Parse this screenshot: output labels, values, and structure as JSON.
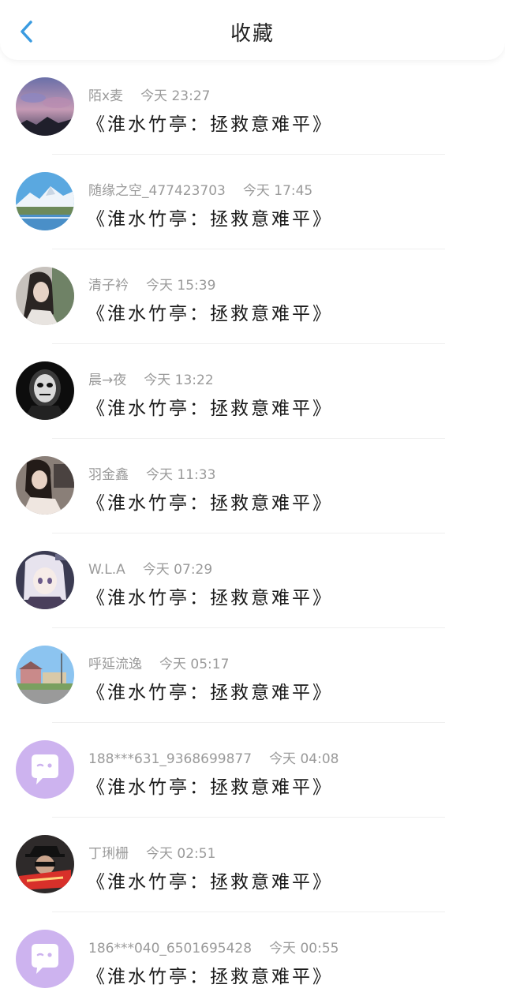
{
  "header": {
    "title": "收藏",
    "back_icon": "chevron-left-icon",
    "accent": "#3a9be0"
  },
  "items": [
    {
      "user": "陌x麦",
      "time": "今天 23:27",
      "content": "《淮水竹亭：拯救意难平》",
      "avatar": "sunset-sky"
    },
    {
      "user": "随缘之空_477423703",
      "time": "今天 17:45",
      "content": "《淮水竹亭：拯救意难平》",
      "avatar": "snowy-mountain"
    },
    {
      "user": "清子衿",
      "time": "今天 15:39",
      "content": "《淮水竹亭：拯救意难平》",
      "avatar": "girl-portrait"
    },
    {
      "user": "晨→夜",
      "time": "今天 13:22",
      "content": "《淮水竹亭：拯救意难平》",
      "avatar": "dark-mask"
    },
    {
      "user": "羽金鑫",
      "time": "今天 11:33",
      "content": "《淮水竹亭：拯救意难平》",
      "avatar": "girl-dark-hair"
    },
    {
      "user": "W.L.A",
      "time": "今天 07:29",
      "content": "《淮水竹亭：拯救意难平》",
      "avatar": "anime-girl"
    },
    {
      "user": "呼延流逸",
      "time": "今天 05:17",
      "content": "《淮水竹亭：拯救意难平》",
      "avatar": "street-house"
    },
    {
      "user": "188***631_9368699877",
      "time": "今天 04:08",
      "content": "《淮水竹亭：拯救意难平》",
      "avatar": "default-chat"
    },
    {
      "user": "丁琍栅",
      "time": "今天 02:51",
      "content": "《淮水竹亭：拯救意难平》",
      "avatar": "man-hat-red"
    },
    {
      "user": "186***040_6501695428",
      "time": "今天 00:55",
      "content": "《淮水竹亭：拯救意难平》",
      "avatar": "default-chat"
    }
  ]
}
